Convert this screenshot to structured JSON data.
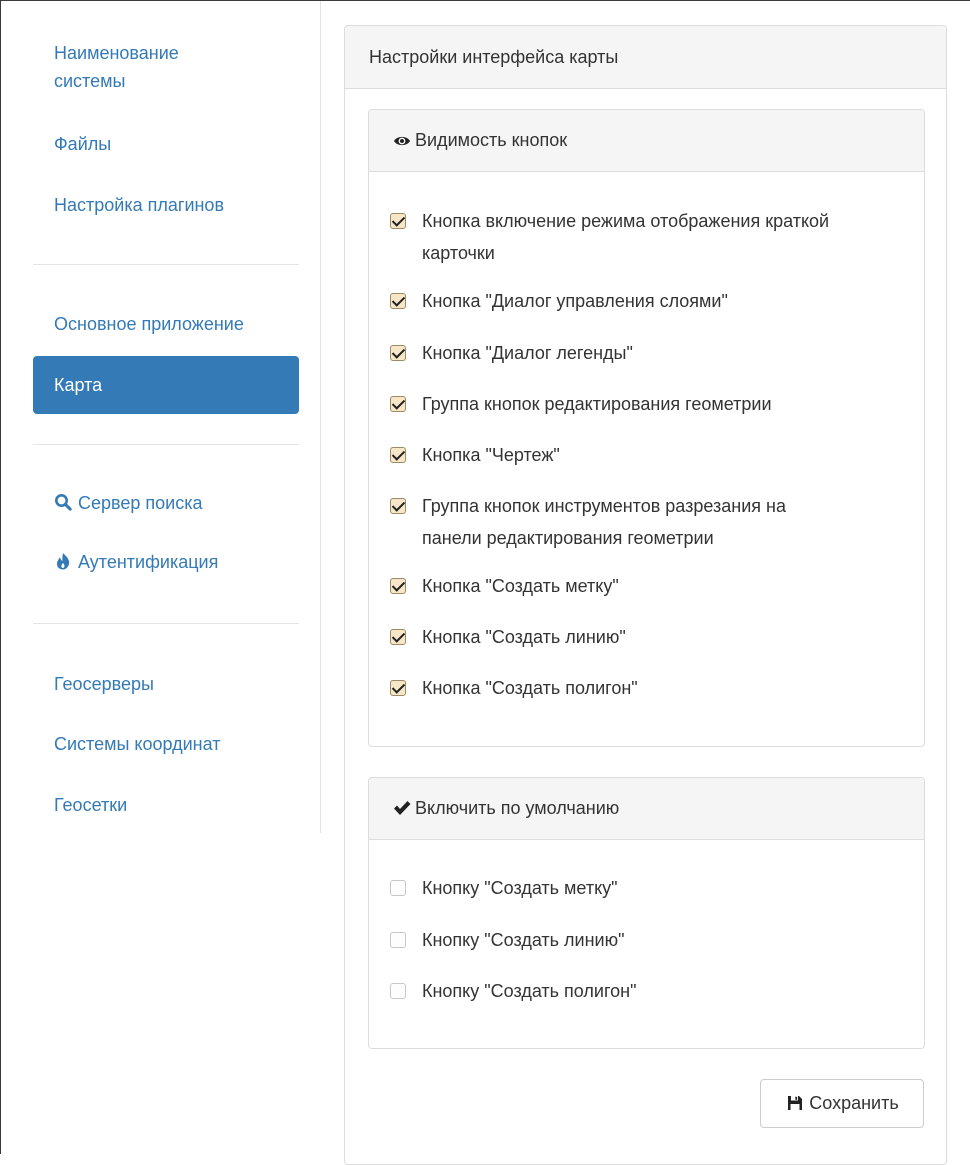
{
  "sidebar": {
    "group1": [
      {
        "label": "Наименование системы"
      },
      {
        "label": "Файлы"
      },
      {
        "label": "Настройка плагинов"
      }
    ],
    "group2": [
      {
        "label": "Основное приложение"
      },
      {
        "label": "Карта",
        "active": true
      }
    ],
    "group3": [
      {
        "label": "Сервер поиска",
        "icon": "search-icon"
      },
      {
        "label": "Аутентификация",
        "icon": "fire-icon"
      }
    ],
    "group4": [
      {
        "label": "Геосерверы"
      },
      {
        "label": "Системы координат"
      },
      {
        "label": "Геосетки"
      }
    ]
  },
  "main": {
    "title": "Настройки интерфейса карты",
    "visibility": {
      "heading": "Видимость кнопок",
      "icon": "eye-icon",
      "items": [
        {
          "line1": "Кнопка включение режима отображения краткой",
          "line2": "карточки",
          "checked": true
        },
        {
          "line1": "Кнопка \"Диалог управления слоями\"",
          "checked": true
        },
        {
          "line1": "Кнопка \"Диалог легенды\"",
          "checked": true
        },
        {
          "line1": "Группа кнопок редактирования геометрии",
          "checked": true
        },
        {
          "line1": "Кнопка \"Чертеж\"",
          "checked": true
        },
        {
          "line1": "Группа кнопок инструментов разрезания на",
          "line2": "панели редактирования геометрии",
          "checked": true
        },
        {
          "line1": "Кнопка \"Создать метку\"",
          "checked": true
        },
        {
          "line1": "Кнопка \"Создать линию\"",
          "checked": true
        },
        {
          "line1": "Кнопка \"Создать полигон\"",
          "checked": true
        }
      ]
    },
    "defaults": {
      "heading": "Включить по умолчанию",
      "icon": "checkmark-icon",
      "items": [
        {
          "line1": "Кнопку \"Создать метку\"",
          "checked": false
        },
        {
          "line1": "Кнопку \"Создать линию\"",
          "checked": false
        },
        {
          "line1": "Кнопку \"Создать полигон\"",
          "checked": false
        }
      ]
    },
    "save_label": "Сохранить",
    "save_icon": "floppy-disk-icon"
  },
  "colors": {
    "link": "#337ab7",
    "active_bg": "#337ab7",
    "panel_heading_bg": "#f5f5f5",
    "border": "#dddddd",
    "checked_bg": "#f6e7c8"
  }
}
